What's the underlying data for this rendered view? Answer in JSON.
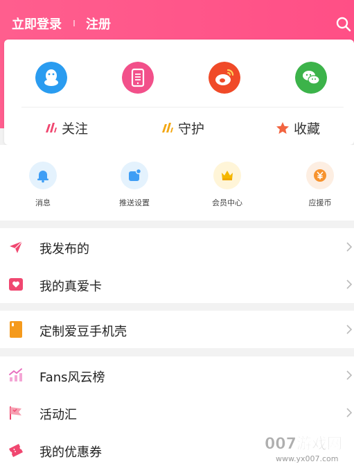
{
  "header": {
    "login_label": "立即登录",
    "register_label": "注册"
  },
  "social": [
    {
      "icon": "qq-icon",
      "color": "#2a9cf0"
    },
    {
      "icon": "phone-icon",
      "color": "#f2508a"
    },
    {
      "icon": "weibo-icon",
      "color": "#f04a28"
    },
    {
      "icon": "wechat-icon",
      "color": "#3cb34a"
    }
  ],
  "stats": [
    {
      "label": "关注",
      "icon": "follow-icon",
      "color": "#f04770"
    },
    {
      "label": "守护",
      "icon": "guard-icon",
      "color": "#f3a712"
    },
    {
      "label": "收藏",
      "icon": "star-icon",
      "color": "#f26440"
    }
  ],
  "quick": [
    {
      "label": "消息",
      "icon": "bell-icon"
    },
    {
      "label": "推送设置",
      "icon": "push-icon"
    },
    {
      "label": "会员中心",
      "icon": "crown-icon"
    },
    {
      "label": "应援币",
      "icon": "coin-icon"
    }
  ],
  "menu": {
    "published": "我发布的",
    "love_card": "我的真爱卡",
    "phone_case": "定制爱豆手机壳",
    "fans_rank": "Fans风云榜",
    "events": "活动汇",
    "coupons": "我的优惠券"
  },
  "watermark": {
    "brand": "007游戏网",
    "url": "www.yx007.com"
  }
}
